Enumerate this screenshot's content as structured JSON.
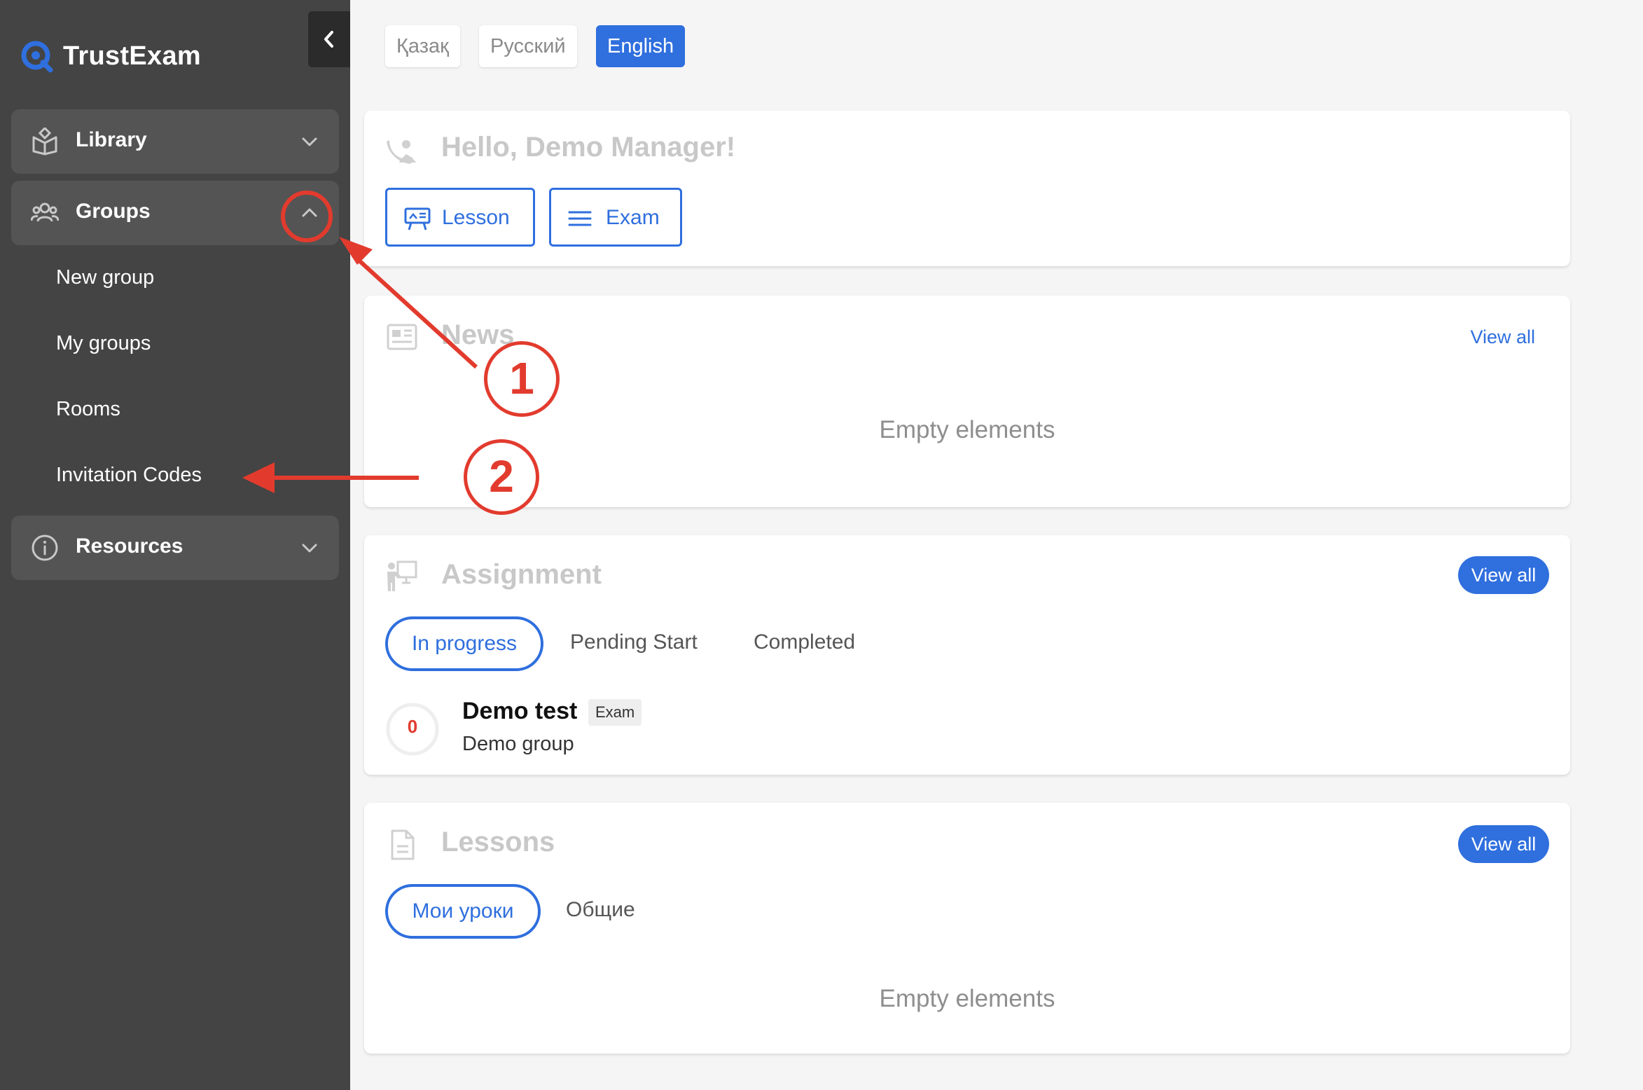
{
  "brand": {
    "name": "TrustExam",
    "accent": "#2f6fde"
  },
  "sidebar": {
    "items": [
      {
        "label": "Library",
        "icon": "book-open-icon"
      },
      {
        "label": "Groups",
        "icon": "users-icon"
      },
      {
        "label": "Resources",
        "icon": "info-icon"
      }
    ],
    "groups_submenu": [
      "New group",
      "My groups",
      "Rooms",
      "Invitation Codes"
    ]
  },
  "languages": [
    {
      "label": "Қазақ",
      "active": false
    },
    {
      "label": "Русский",
      "active": false
    },
    {
      "label": "English",
      "active": true
    }
  ],
  "greeting": {
    "title": "Hello, Demo Manager!",
    "lesson_label": "Lesson",
    "exam_label": "Exam"
  },
  "news": {
    "title": "News",
    "view_all": "View all",
    "empty": "Empty elements"
  },
  "assignment": {
    "title": "Assignment",
    "view_all": "View all",
    "tabs": [
      "In progress",
      "Pending Start",
      "Completed"
    ],
    "item": {
      "name": "Demo test",
      "badge": "Exam",
      "group": "Demo group",
      "score": "0"
    }
  },
  "lessons": {
    "title": "Lessons",
    "view_all": "View all",
    "tabs": [
      "Мои уроки",
      "Общие"
    ],
    "empty": "Empty elements"
  },
  "annotations": {
    "one": "1",
    "two": "2",
    "color": "#e23b2e"
  }
}
